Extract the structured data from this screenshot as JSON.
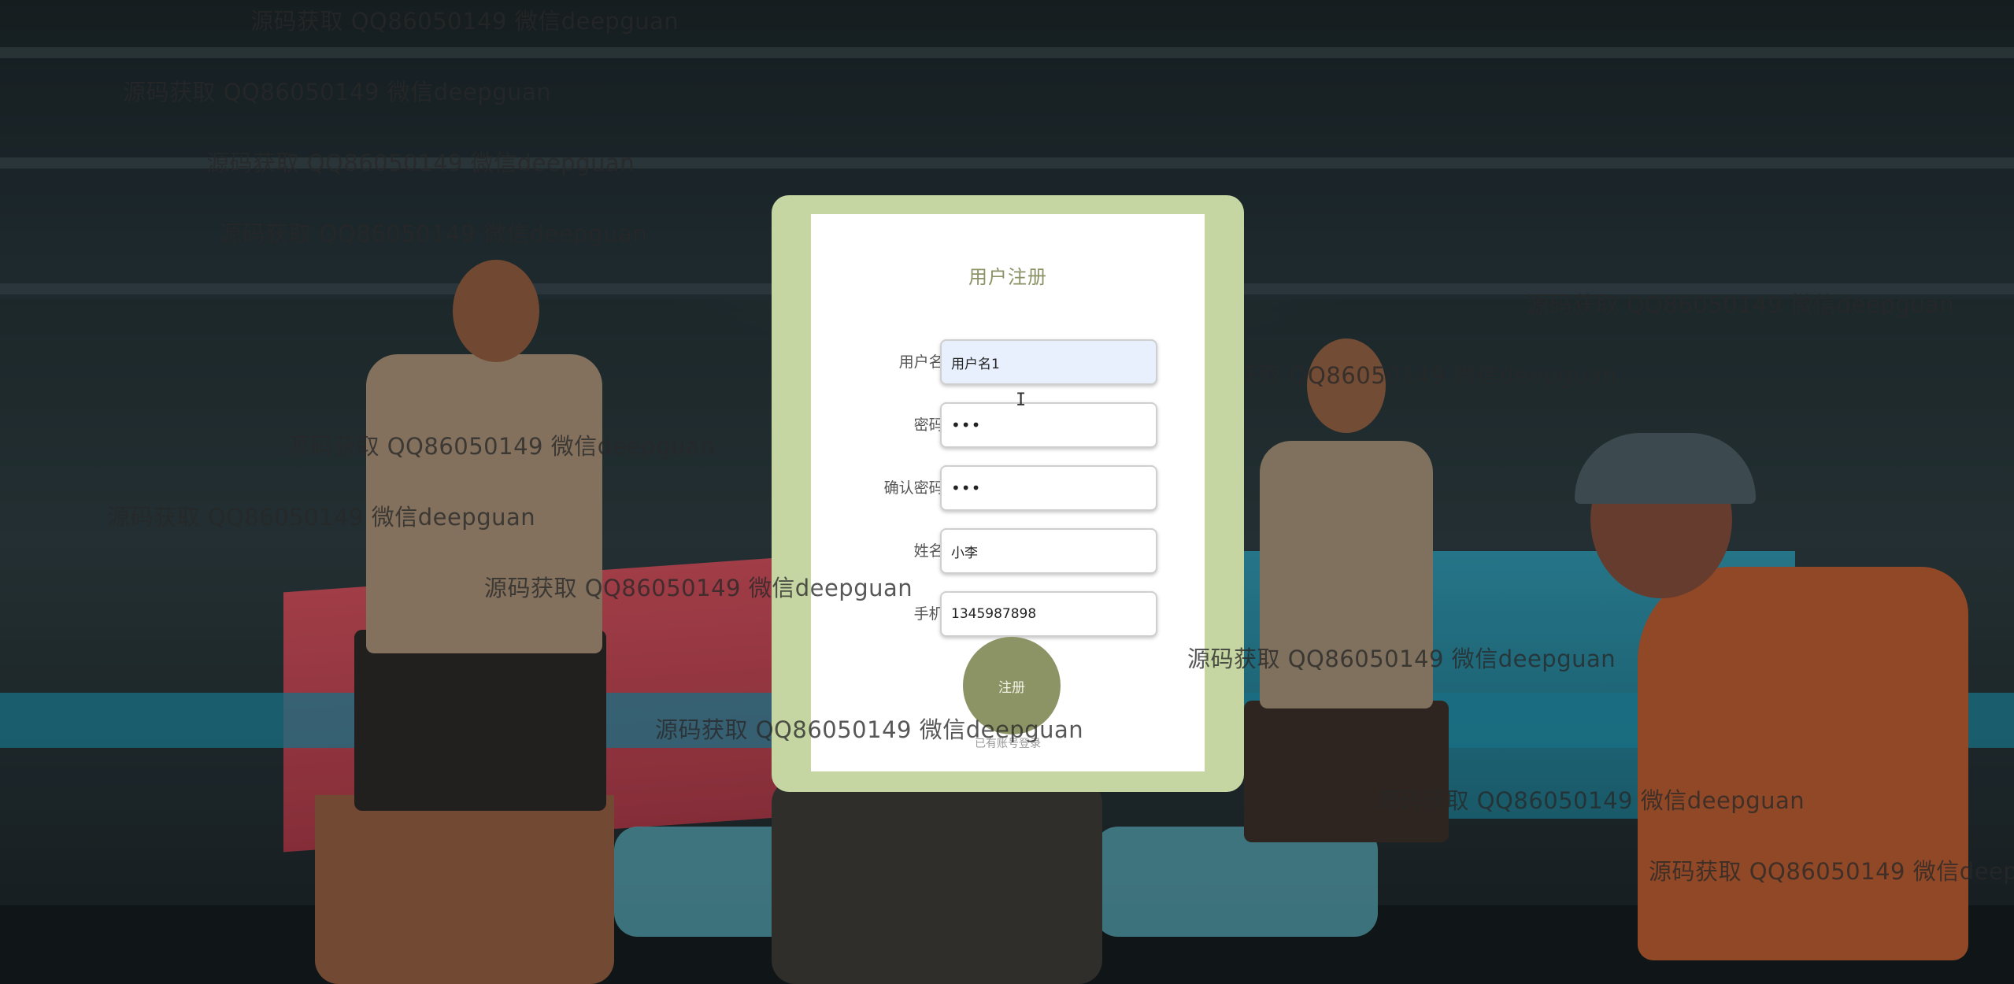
{
  "form": {
    "title": "用户注册",
    "fields": [
      {
        "label": "用户名:",
        "value": "用户名1",
        "type": "text"
      },
      {
        "label": "密码:",
        "value": "•••",
        "type": "password"
      },
      {
        "label": "确认密码:",
        "value": "•••",
        "type": "password"
      },
      {
        "label": "姓名:",
        "value": "小李",
        "type": "text"
      },
      {
        "label": "手机:",
        "value": "1345987898",
        "type": "text"
      }
    ],
    "submit_label": "注册",
    "login_link": "已有账号登录"
  },
  "watermark": {
    "text": "源码获取 QQ86050149 微信deepguan"
  },
  "colors": {
    "card_border": "#c6d6a3",
    "title": "#8a9266",
    "button": "#8c9466",
    "autofill_bg": "#e8f0fe"
  },
  "icons": {
    "cursor": "text-cursor-icon"
  }
}
